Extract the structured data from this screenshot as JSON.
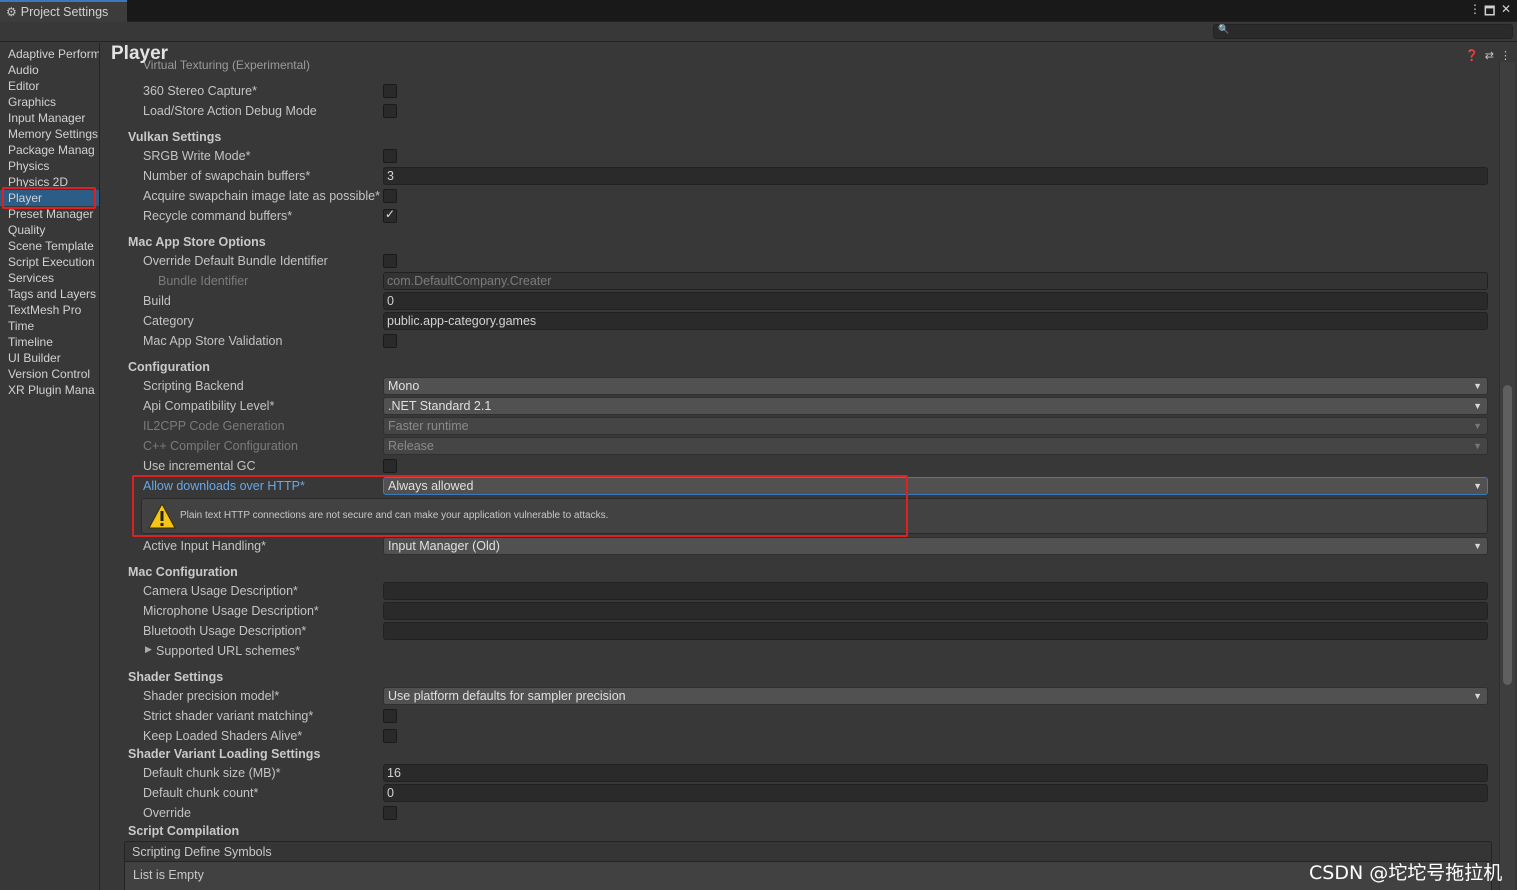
{
  "window": {
    "tab_title": "Project Settings",
    "controls": [
      "⋮",
      "🗖",
      "✕"
    ]
  },
  "sidebar": {
    "items": [
      {
        "label": "Adaptive Perform"
      },
      {
        "label": "Audio"
      },
      {
        "label": "Editor"
      },
      {
        "label": "Graphics"
      },
      {
        "label": "Input Manager"
      },
      {
        "label": "Memory Settings"
      },
      {
        "label": "Package Manag"
      },
      {
        "label": "Physics"
      },
      {
        "label": "Physics 2D"
      },
      {
        "label": "Player",
        "selected": true
      },
      {
        "label": "Preset Manager"
      },
      {
        "label": "Quality"
      },
      {
        "label": "Scene Template"
      },
      {
        "label": "Script Execution"
      },
      {
        "label": "Services"
      },
      {
        "label": "Tags and Layers"
      },
      {
        "label": "TextMesh Pro"
      },
      {
        "label": "Time"
      },
      {
        "label": "Timeline"
      },
      {
        "label": "UI Builder"
      },
      {
        "label": "Version Control"
      },
      {
        "label": "XR Plugin Mana"
      }
    ]
  },
  "main": {
    "title": "Player",
    "partial_top_label": "Virtual Texturing (Experimental)",
    "rows": {
      "stereo_capture": {
        "label": "360 Stereo Capture*",
        "checked": false
      },
      "loadstore_debug": {
        "label": "Load/Store Action Debug Mode",
        "checked": false
      },
      "vulkan_section": "Vulkan Settings",
      "srgb_write": {
        "label": "SRGB Write Mode*",
        "checked": false
      },
      "swapchain_buffers": {
        "label": "Number of swapchain buffers*",
        "value": "3"
      },
      "acquire_late": {
        "label": "Acquire swapchain image late as possible*",
        "checked": false
      },
      "recycle_buffers": {
        "label": "Recycle command buffers*",
        "checked": true
      },
      "mac_store_section": "Mac App Store Options",
      "override_bundle": {
        "label": "Override Default Bundle Identifier",
        "checked": false
      },
      "bundle_id": {
        "label": "Bundle Identifier",
        "value": "com.DefaultCompany.Creater"
      },
      "build": {
        "label": "Build",
        "value": "0"
      },
      "category": {
        "label": "Category",
        "value": "public.app-category.games"
      },
      "store_validation": {
        "label": "Mac App Store Validation",
        "checked": false
      },
      "config_section": "Configuration",
      "scripting_backend": {
        "label": "Scripting Backend",
        "value": "Mono"
      },
      "api_compat": {
        "label": "Api Compatibility Level*",
        "value": ".NET Standard 2.1"
      },
      "il2cpp_gen": {
        "label": "IL2CPP Code Generation",
        "value": "Faster runtime"
      },
      "cpp_compiler": {
        "label": "C++ Compiler Configuration",
        "value": "Release"
      },
      "incremental_gc": {
        "label": "Use incremental GC",
        "checked": false
      },
      "allow_http": {
        "label": "Allow downloads over HTTP*",
        "value": "Always allowed"
      },
      "http_warning": "Plain text HTTP connections are not secure and can make your application vulnerable to attacks.",
      "input_handling": {
        "label": "Active Input Handling*",
        "value": "Input Manager (Old)"
      },
      "mac_config_section": "Mac Configuration",
      "camera_usage": {
        "label": "Camera Usage Description*",
        "value": ""
      },
      "mic_usage": {
        "label": "Microphone Usage Description*",
        "value": ""
      },
      "bt_usage": {
        "label": "Bluetooth Usage Description*",
        "value": ""
      },
      "url_schemes": {
        "label": "Supported URL schemes*"
      },
      "shader_section": "Shader Settings",
      "shader_precision": {
        "label": "Shader precision model*",
        "value": "Use platform defaults for sampler precision"
      },
      "strict_variant": {
        "label": "Strict shader variant matching*",
        "checked": false
      },
      "keep_shaders": {
        "label": "Keep Loaded Shaders Alive*",
        "checked": false
      },
      "variant_loading_section": "Shader Variant Loading Settings",
      "chunk_size": {
        "label": "Default chunk size (MB)*",
        "value": "16"
      },
      "chunk_count": {
        "label": "Default chunk count*",
        "value": "0"
      },
      "override": {
        "label": "Override",
        "checked": false
      },
      "script_compilation_section": "Script Compilation",
      "define_symbols": {
        "label": "Scripting Define Symbols"
      },
      "list_empty": "List is Empty"
    }
  },
  "watermark": "CSDN @坨坨号拖拉机",
  "colors": {
    "highlight": "#e02020",
    "link": "#6aa7e4",
    "selection": "#2c5d87"
  }
}
